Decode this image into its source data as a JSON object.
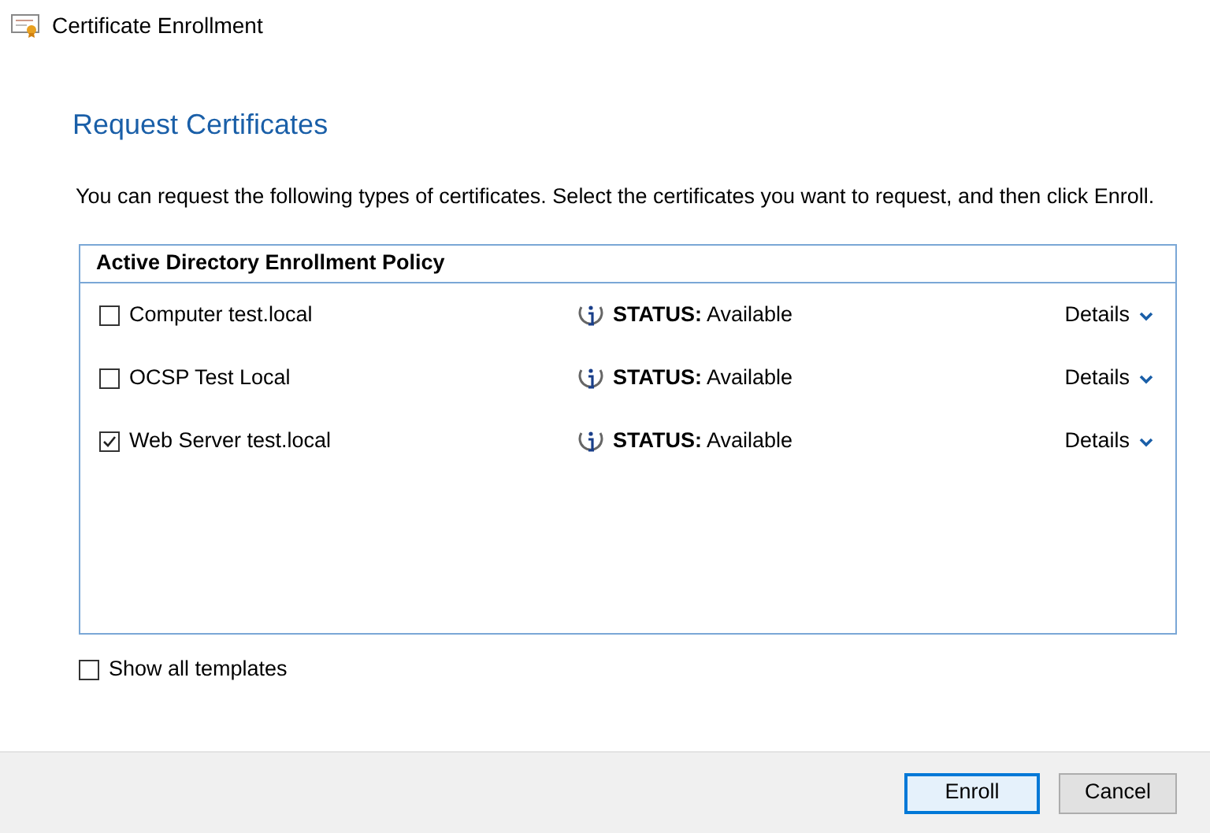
{
  "window": {
    "title": "Certificate Enrollment"
  },
  "heading": "Request Certificates",
  "description": "You can request the following types of certificates. Select the certificates you want to request, and then click Enroll.",
  "policy": {
    "title": "Active Directory Enrollment Policy",
    "certificates": [
      {
        "name": "Computer test.local",
        "checked": false,
        "status": "**STATUS:** Available",
        "details": "Details"
      },
      {
        "name": "OCSP Test Local",
        "checked": false,
        "status": "**STATUS:** Available",
        "details": "Details"
      },
      {
        "name": "Web Server test.local",
        "checked": true,
        "status": "**STATUS:** Available",
        "details": "Details"
      }
    ]
  },
  "show_all_templates": {
    "label": "Show all templates",
    "checked": false
  },
  "buttons": [
    {
      "label": "Enroll",
      "kind": "default"
    },
    {
      "label": "Cancel",
      "kind": "normal"
    }
  ]
}
